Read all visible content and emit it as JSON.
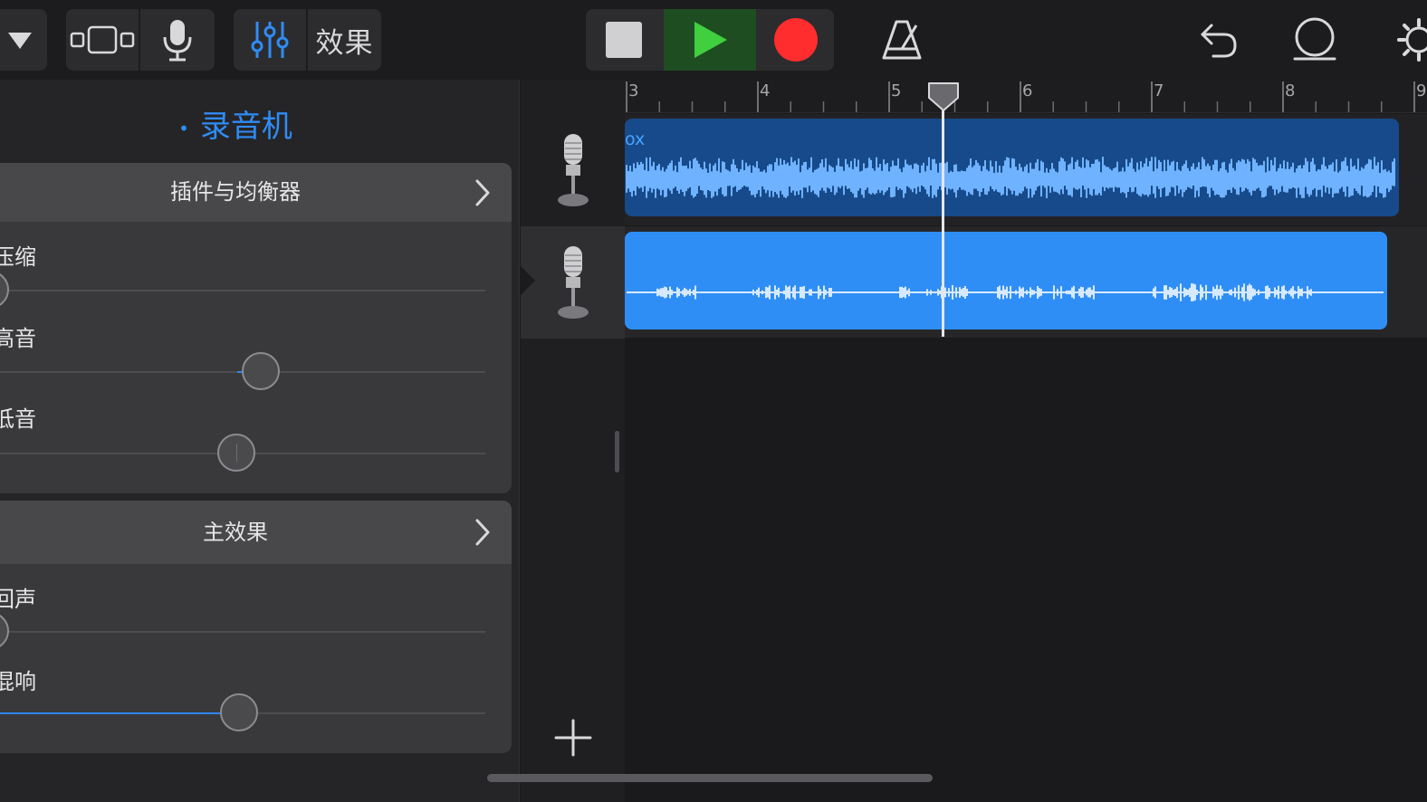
{
  "toolbar": {
    "effects_label": "效果",
    "icons": [
      "dropdown-triangle-icon",
      "tracks-view-icon",
      "microphone-icon",
      "mixer-sliders-icon",
      "stop-icon",
      "play-icon",
      "record-icon",
      "metronome-icon",
      "undo-icon",
      "loop-icon",
      "settings-gear-icon"
    ],
    "colors": {
      "play_bg": "#1f4d22",
      "play_icon": "#3fcf3f",
      "record": "#ff2d2d",
      "accent": "#2f8cf5"
    }
  },
  "inspector": {
    "instrument_title": "录音机",
    "plugins_card": {
      "title": "插件与均衡器",
      "controls": [
        {
          "label": "压缩",
          "value": 0.0
        },
        {
          "label": "高音",
          "value": 0.5
        },
        {
          "label": "低音",
          "value": 0.5
        }
      ]
    },
    "master_card": {
      "title": "主效果",
      "controls": [
        {
          "label": "回声",
          "value": 0.0
        },
        {
          "label": "混响",
          "value": 0.49
        }
      ]
    }
  },
  "ruler": {
    "bars": [
      "3",
      "4",
      "5",
      "6",
      "7",
      "8",
      "9"
    ]
  },
  "tracks": [
    {
      "name": "track-1",
      "icon": "studio-microphone-icon",
      "region_name": "ox",
      "selected": false
    },
    {
      "name": "track-2",
      "icon": "studio-microphone-icon",
      "region_name": "",
      "selected": true
    }
  ],
  "playhead_bar": 5.5
}
